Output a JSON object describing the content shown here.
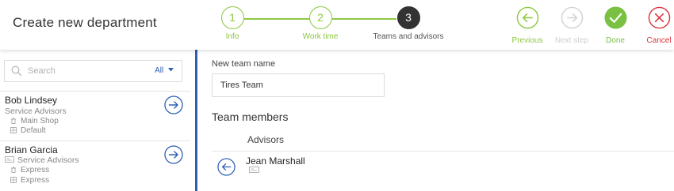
{
  "header": {
    "title": "Create new department"
  },
  "steps": [
    {
      "number": "1",
      "label": "Info",
      "state": "done"
    },
    {
      "number": "2",
      "label": "Work time",
      "state": "done"
    },
    {
      "number": "3",
      "label": "Teams and advisors",
      "state": "active"
    }
  ],
  "actions": {
    "previous": {
      "label": "Previous",
      "color": "#8cc83f"
    },
    "next": {
      "label": "Next step",
      "color": "#cfcfcf"
    },
    "done": {
      "label": "Done",
      "color": "#79c043"
    },
    "cancel": {
      "label": "Cancel",
      "color": "#d9363e"
    }
  },
  "search": {
    "placeholder": "Search",
    "filter": "All"
  },
  "people": [
    {
      "name": "Bob Lindsey",
      "role": "Service Advisors",
      "details": [
        "Main Shop",
        "Default"
      ]
    },
    {
      "name": "Brian Garcia",
      "role": "Service Advisors",
      "details": [
        "Express",
        "Express"
      ]
    }
  ],
  "team": {
    "name_label": "New team name",
    "name_value": "Tires Team",
    "members_title": "Team members",
    "advisors_heading": "Advisors",
    "members": [
      {
        "name": "Jean Marshall"
      }
    ]
  },
  "colors": {
    "accent_blue": "#2e5fb3",
    "step_green": "#8cc83f"
  }
}
